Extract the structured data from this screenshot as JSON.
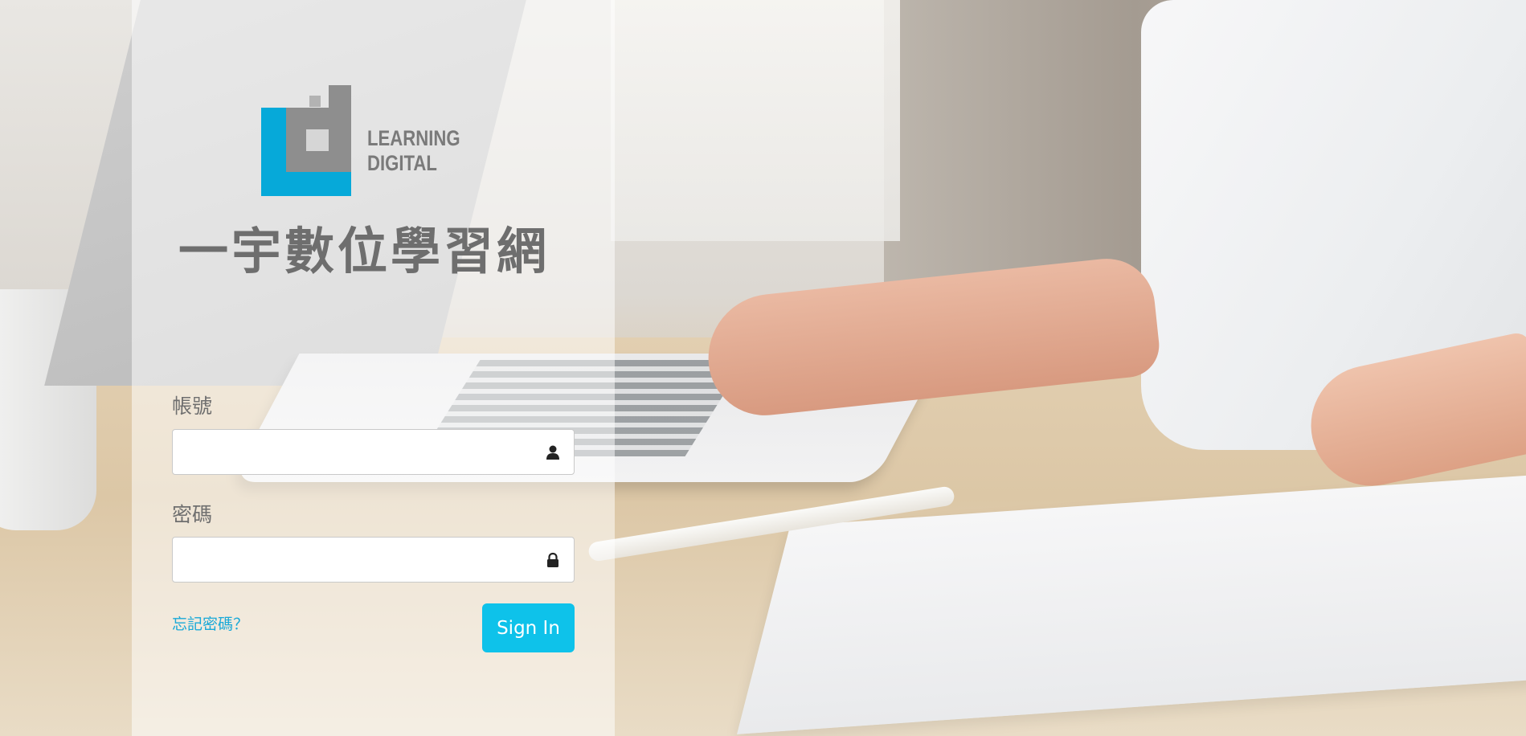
{
  "brand": {
    "logo_line1": "LEARNING",
    "logo_line2": "DIGITAL",
    "name_cn": "一宇數位學習網",
    "colors": {
      "logo_blue": "#06a9d9",
      "logo_gray": "#8c8c8c",
      "logo_dark": "#7a7a7a"
    }
  },
  "login": {
    "account_label": "帳號",
    "account_value": "",
    "account_icon": "user-icon",
    "password_label": "密碼",
    "password_value": "",
    "password_icon": "lock-icon",
    "forgot_link": "忘記密碼？",
    "signin_button": "Sign In",
    "accent_color": "#0ec2ea"
  }
}
